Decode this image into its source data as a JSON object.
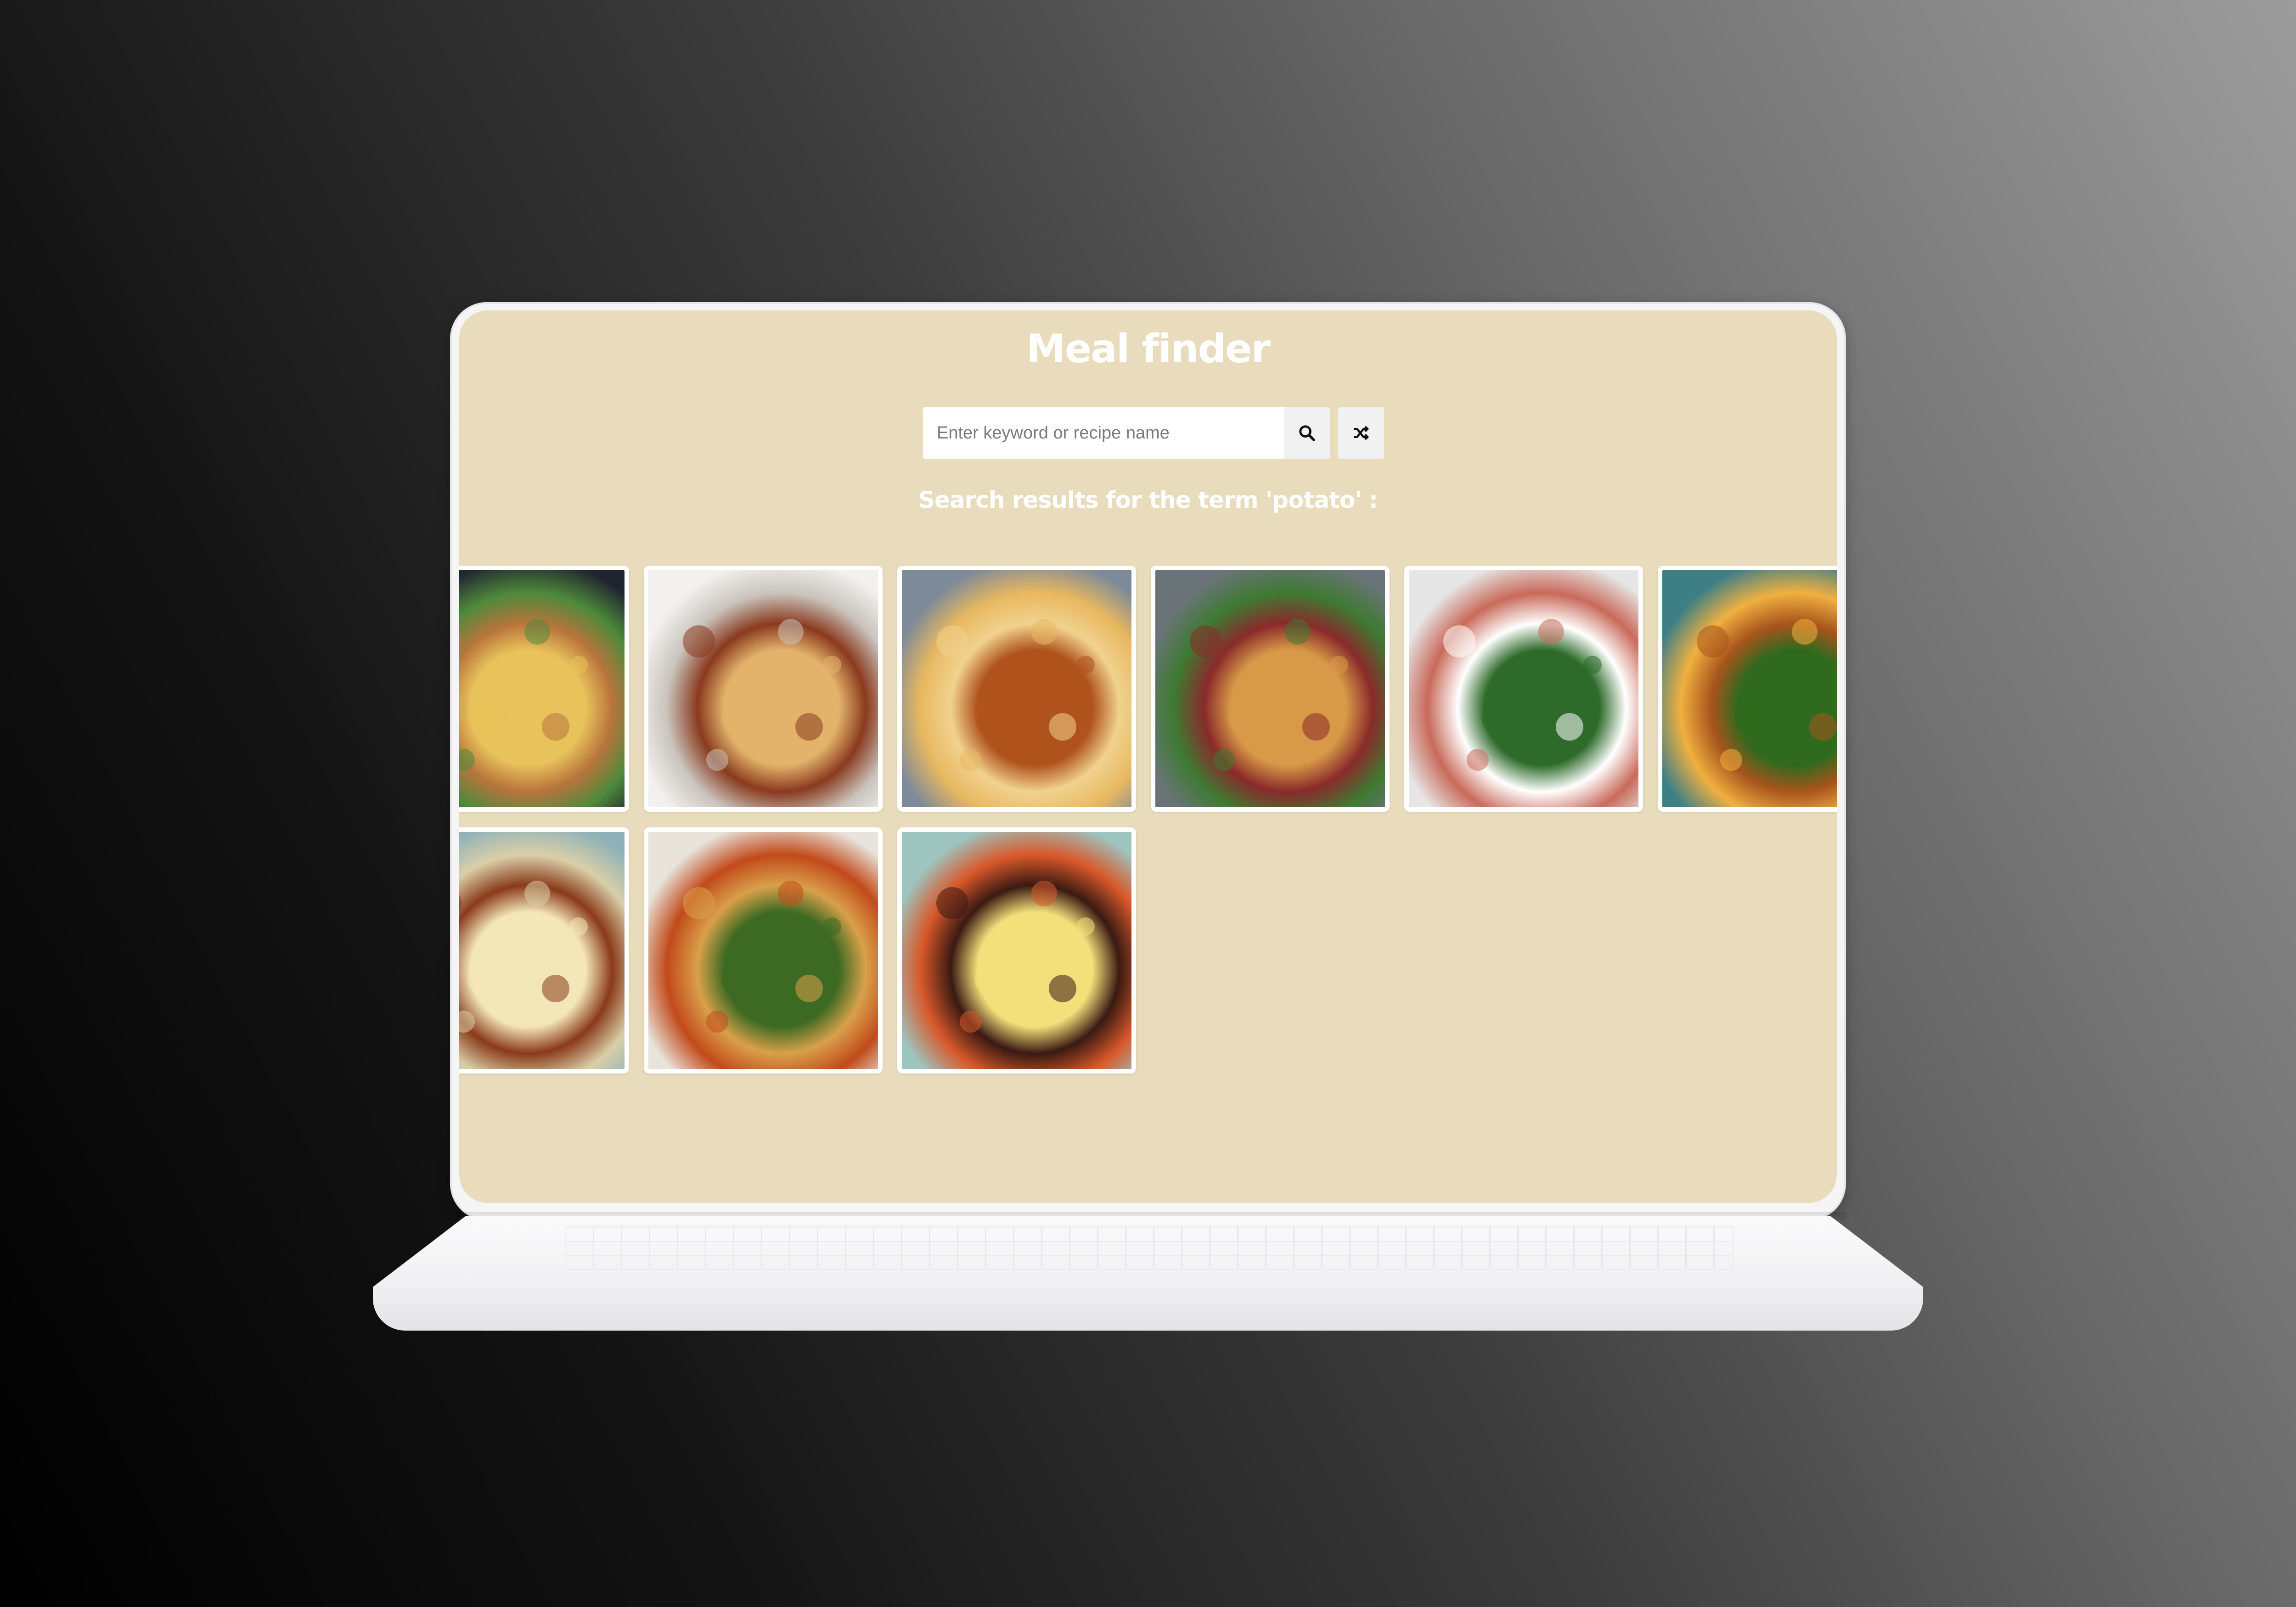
{
  "app": {
    "title": "Meal finder"
  },
  "search": {
    "placeholder": "Enter keyword or recipe name",
    "value": ""
  },
  "buttons": {
    "search_icon": "search-icon",
    "random_icon": "shuffle-icon"
  },
  "results": {
    "heading": "Search results for the term 'potato' :",
    "meals": [
      {
        "kind": "skillet-potatoes",
        "colors": [
          "#1f2430",
          "#e8c25a",
          "#b8743c",
          "#4e8a3a"
        ]
      },
      {
        "kind": "meat-pie",
        "colors": [
          "#f3f1ee",
          "#e3b36b",
          "#8a3a1e",
          "#c9c3bc"
        ]
      },
      {
        "kind": "potato-gratin",
        "colors": [
          "#7d8a99",
          "#b0521c",
          "#f0d28e",
          "#e8b860"
        ]
      },
      {
        "kind": "potato-bake-with-meat",
        "colors": [
          "#6a7478",
          "#d89a48",
          "#8a2a2a",
          "#3e7a32"
        ]
      },
      {
        "kind": "salad-bowl",
        "colors": [
          "#e6e6e6",
          "#2e6b2a",
          "#ffffff",
          "#c96a5a"
        ]
      },
      {
        "kind": "chicken-broccoli",
        "colors": [
          "#3e7f86",
          "#2f6a1e",
          "#a8541c",
          "#f0b040"
        ]
      },
      {
        "kind": "pulled-pork-mac",
        "colors": [
          "#8fb2b8",
          "#f3e6b8",
          "#8a3a1a",
          "#d9cfa8"
        ]
      },
      {
        "kind": "chicken-apple-zucchini",
        "colors": [
          "#e8e4dc",
          "#3d6a22",
          "#d9a04a",
          "#c24a1a"
        ]
      },
      {
        "kind": "meatloaf-mash",
        "colors": [
          "#9ec4bf",
          "#f2e07a",
          "#3a1a12",
          "#d8582a"
        ]
      }
    ]
  }
}
